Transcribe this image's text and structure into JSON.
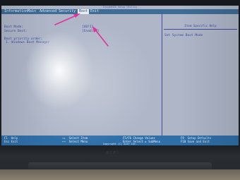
{
  "bios": {
    "title": "InsydeH20 Setup Utility",
    "menu": [
      {
        "label": "Information",
        "active": false
      },
      {
        "label": "Main",
        "active": false
      },
      {
        "label": "Advanced",
        "active": false
      },
      {
        "label": "Security",
        "active": false
      },
      {
        "label": "Boot",
        "active": true
      },
      {
        "label": "Exit",
        "active": false
      }
    ],
    "settings": [
      {
        "label": "Boot Mode:",
        "value": "[UEFI]"
      },
      {
        "label": "Secure Boot:",
        "value": "[Enabled]"
      }
    ],
    "boot_priority_header": "Boot priority order:",
    "boot_priority": [
      "1. Windows Boot Manager"
    ],
    "help": {
      "title": "Item Specific Help",
      "text": "Set System Boot Mode"
    },
    "footer": {
      "keys": [
        {
          "key": "F1",
          "action": "Help"
        },
        {
          "key": "Esc",
          "action": "Exit"
        },
        {
          "key": "↑↓",
          "action": "Select Item"
        },
        {
          "key": "←→",
          "action": "Select Menu"
        },
        {
          "key": "F5/F6",
          "action": "Change Values"
        },
        {
          "key": "Enter",
          "action": "Select ► SubMenu"
        },
        {
          "key": "F9",
          "action": "Setup Defaults"
        },
        {
          "key": "F10",
          "action": "Save and Exit"
        }
      ],
      "copyright": "Copyright (C) Acer Inc."
    },
    "colors": {
      "menubar": "#3d6c96",
      "footer": "#2f6fa8",
      "text": "#3a4ea0",
      "annotation_arrow": "#e0349a"
    }
  },
  "laptop": {
    "logo": "acer"
  }
}
